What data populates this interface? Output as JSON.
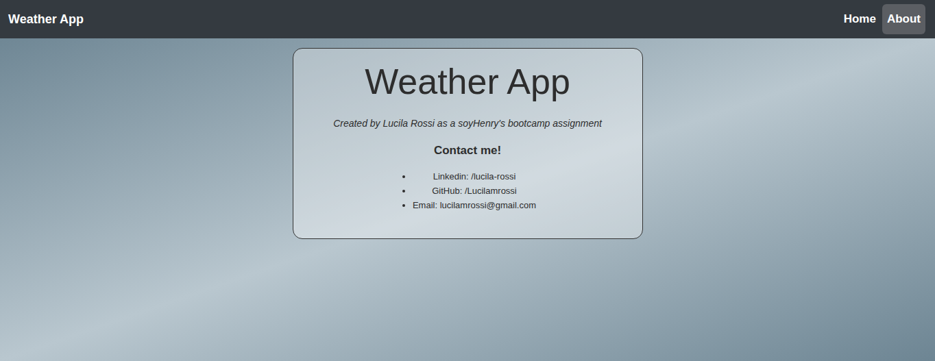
{
  "navbar": {
    "brand": "Weather App",
    "links": [
      {
        "label": "Home",
        "selected": false
      },
      {
        "label": "About",
        "selected": true
      }
    ]
  },
  "about": {
    "title": "Weather App",
    "subtitle": "Created by Lucila Rossi as a soyHenry's bootcamp assignment",
    "contact_heading": "Contact me!",
    "contacts": [
      "Linkedin: /lucila-rossi",
      "GitHub: /Lucilamrossi",
      "Email: lucilamrossi@gmail.com"
    ]
  }
}
